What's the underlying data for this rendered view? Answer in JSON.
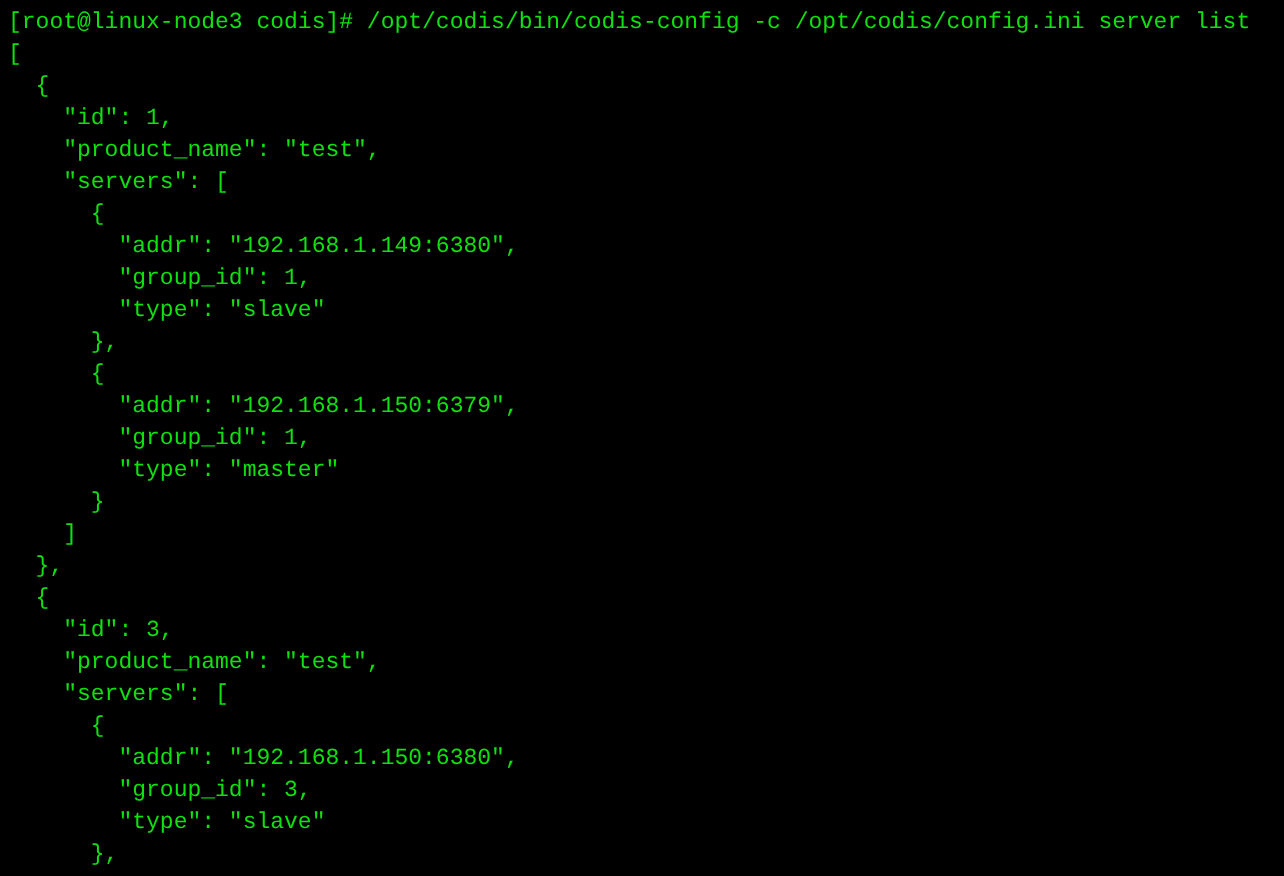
{
  "terminal": {
    "lines": [
      "[root@linux-node3 codis]# /opt/codis/bin/codis-config -c /opt/codis/config.ini server list",
      "[",
      "  {",
      "    \"id\": 1,",
      "    \"product_name\": \"test\",",
      "    \"servers\": [",
      "      {",
      "        \"addr\": \"192.168.1.149:6380\",",
      "        \"group_id\": 1,",
      "        \"type\": \"slave\"",
      "      },",
      "      {",
      "        \"addr\": \"192.168.1.150:6379\",",
      "        \"group_id\": 1,",
      "        \"type\": \"master\"",
      "      }",
      "    ]",
      "  },",
      "  {",
      "    \"id\": 3,",
      "    \"product_name\": \"test\",",
      "    \"servers\": [",
      "      {",
      "        \"addr\": \"192.168.1.150:6380\",",
      "        \"group_id\": 3,",
      "        \"type\": \"slave\"",
      "      },"
    ]
  }
}
